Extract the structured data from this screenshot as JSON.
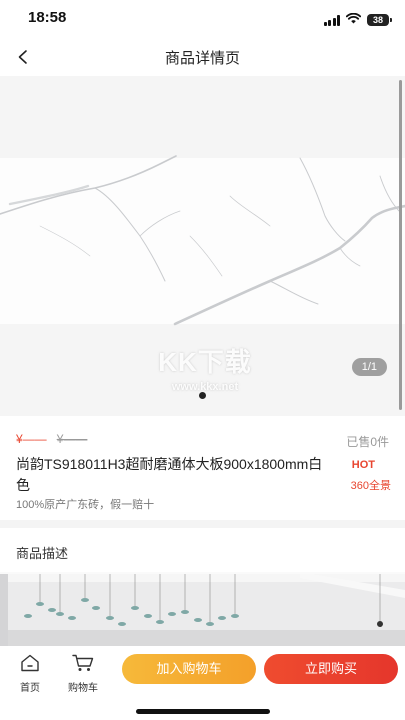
{
  "status_bar": {
    "time": "18:58",
    "battery": "38",
    "icons": [
      "signal-icon",
      "wifi-icon",
      "battery-icon"
    ]
  },
  "nav": {
    "title": "商品详情页",
    "back_icon": "chevron-left-icon"
  },
  "gallery": {
    "watermark_main": "KK下载",
    "watermark_sub": "www.kkx.net",
    "counter": "1/1",
    "current_index": 1,
    "total": 1
  },
  "product": {
    "price": "¥——",
    "original_price": "¥——",
    "sold": "已售0件",
    "name": "尚韵TS918011H3超耐磨通体大板900x1800mm白色",
    "hot_tag": "HOT",
    "panorama_link": "360全景",
    "promise": "100%原产广东砖，假一赔十"
  },
  "description": {
    "title": "商品描述"
  },
  "bottom_bar": {
    "home_label": "首页",
    "cart_label": "购物车",
    "add_to_cart": "加入购物车",
    "buy_now": "立即购买"
  },
  "colors": {
    "accent_red": "#e8452f",
    "button_orange": "#f4a02a",
    "button_red": "#e5362c"
  }
}
